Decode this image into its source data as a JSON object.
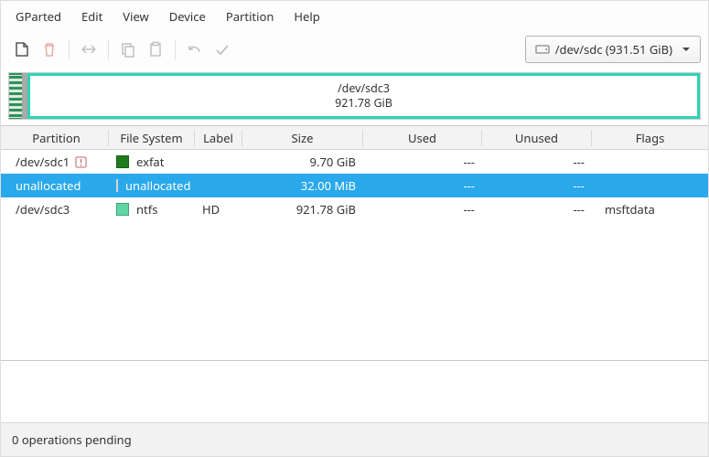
{
  "menu": [
    "GParted",
    "Edit",
    "View",
    "Device",
    "Partition",
    "Help"
  ],
  "toolbar": {
    "new": "new-partition-icon",
    "delete": "delete-icon",
    "resize": "resize-icon",
    "copy": "copy-icon",
    "paste": "paste-icon",
    "undo": "undo-icon",
    "apply": "apply-icon"
  },
  "device": {
    "label": "/dev/sdc  (931.51 GiB)"
  },
  "map": {
    "segments": [
      {
        "label": "/dev/sdc3",
        "size": "921.78 GiB"
      }
    ]
  },
  "columns": {
    "partition": "Partition",
    "fs": "File System",
    "label": "Label",
    "size": "Size",
    "used": "Used",
    "unused": "Unused",
    "flags": "Flags"
  },
  "swatch": {
    "exfat": "#1e7c1e",
    "unallocated": "#a9a9a9",
    "ntfs": "#5fd6a3"
  },
  "rows": [
    {
      "name": "/dev/sdc1",
      "warn": true,
      "fs": "exfat",
      "swatch": "exfat",
      "label": "",
      "size": "9.70 GiB",
      "used": "---",
      "unused": "---",
      "flags": "",
      "selected": false
    },
    {
      "name": "unallocated",
      "warn": false,
      "fs": "unallocated",
      "swatch": "unallocated",
      "label": "",
      "size": "32.00 MiB",
      "used": "---",
      "unused": "---",
      "flags": "",
      "selected": true
    },
    {
      "name": "/dev/sdc3",
      "warn": false,
      "fs": "ntfs",
      "swatch": "ntfs",
      "label": "HD",
      "size": "921.78 GiB",
      "used": "---",
      "unused": "---",
      "flags": "msftdata",
      "selected": false
    }
  ],
  "status": "0 operations pending"
}
